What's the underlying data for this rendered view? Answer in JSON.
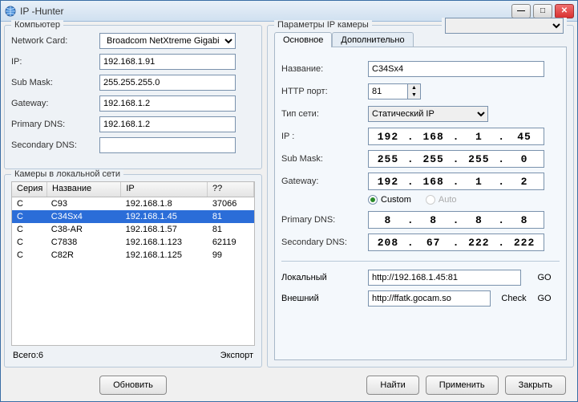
{
  "window": {
    "title": "IP  -Hunter"
  },
  "computer": {
    "legend": "Компьютер",
    "network_card_label": "Network Card:",
    "network_card_value": "Broadcom NetXtreme Gigabit Ethe",
    "ip_label": "IP:",
    "ip_value": "192.168.1.91",
    "submask_label": "Sub Mask:",
    "submask_value": "255.255.255.0",
    "gateway_label": "Gateway:",
    "gateway_value": "192.168.1.2",
    "pdns_label": "Primary DNS:",
    "pdns_value": "192.168.1.2",
    "sdns_label": "Secondary DNS:",
    "sdns_value": ""
  },
  "list": {
    "legend": "Камеры в локальной сети",
    "h1": "Серия",
    "h2": "Название",
    "h3": "IP",
    "h4": "??",
    "rows": [
      {
        "c1": "C",
        "c2": "C93",
        "c3": "192.168.1.8",
        "c4": "37066",
        "sel": false
      },
      {
        "c1": "C",
        "c2": "C34Sx4",
        "c3": "192.168.1.45",
        "c4": "81",
        "sel": true
      },
      {
        "c1": "C",
        "c2": "C38-AR",
        "c3": "192.168.1.57",
        "c4": "81",
        "sel": false
      },
      {
        "c1": "C",
        "c2": "C7838",
        "c3": "192.168.1.123",
        "c4": "62119",
        "sel": false
      },
      {
        "c1": "C",
        "c2": "C82R",
        "c3": "192.168.1.125",
        "c4": "99",
        "sel": false
      }
    ],
    "total_label": "Всего:6",
    "export_label": "Экспорт"
  },
  "buttons": {
    "refresh": "Обновить",
    "find": "Найти",
    "apply": "Применить",
    "close": "Закрыть"
  },
  "params": {
    "legend": "Параметры IP камеры",
    "tab_main": "Основное",
    "tab_extra": "Дополнительно",
    "name_label": "Название:",
    "name_value": "C34Sx4",
    "http_label": "HTTP порт:",
    "http_value": "81",
    "nettype_label": "Тип сети:",
    "nettype_value": "Статический IP",
    "ip_label": "IP  :",
    "ip_value": [
      "192",
      "168",
      "1",
      "45"
    ],
    "submask_label": "Sub Mask:",
    "submask_value": [
      "255",
      "255",
      "255",
      "0"
    ],
    "gateway_label": "Gateway:",
    "gateway_value": [
      "192",
      "168",
      "1",
      "2"
    ],
    "radio_custom": "Custom",
    "radio_auto": "Auto",
    "pdns_label": "Primary DNS:",
    "pdns_value": [
      "8",
      "8",
      "8",
      "8"
    ],
    "sdns_label": "Secondary DNS:",
    "sdns_value": [
      "208",
      "67",
      "222",
      "222"
    ],
    "local_label": "Локальный",
    "local_url": "http://192.168.1.45:81",
    "ext_label": "Внешний",
    "ext_url": "http://ffatk.gocam.so",
    "go": "GO",
    "check": "Check"
  }
}
